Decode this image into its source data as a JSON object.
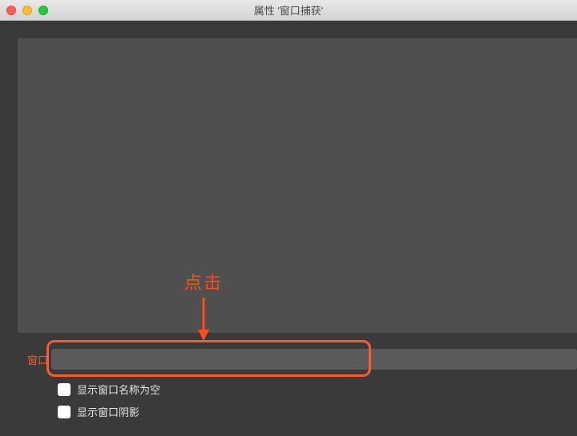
{
  "titlebar": {
    "title": "属性 '窗口捕获'"
  },
  "annotation": {
    "text": "点击"
  },
  "form": {
    "window_label": "窗口",
    "window_value": "",
    "checkbox_empty_name": "显示窗口名称为空",
    "checkbox_shadow": "显示窗口阴影"
  },
  "colors": {
    "highlight": "#ff5a2a"
  }
}
